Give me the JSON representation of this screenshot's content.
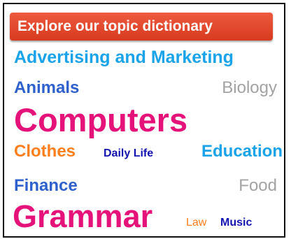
{
  "header": {
    "title": "Explore our topic dictionary"
  },
  "topics": [
    {
      "id": "advertising-and-marketing",
      "label": "Advertising and Marketing",
      "color": "#1aa3e8"
    },
    {
      "id": "animals",
      "label": "Animals",
      "color": "#2e61cc"
    },
    {
      "id": "biology",
      "label": "Biology",
      "color": "#a3a3a3"
    },
    {
      "id": "computers",
      "label": "Computers",
      "color": "#e5127a"
    },
    {
      "id": "clothes",
      "label": "Clothes",
      "color": "#ff7f1e"
    },
    {
      "id": "daily-life",
      "label": "Daily Life",
      "color": "#1414b0"
    },
    {
      "id": "education",
      "label": "Education",
      "color": "#1aa3e8"
    },
    {
      "id": "finance",
      "label": "Finance",
      "color": "#2e61cc"
    },
    {
      "id": "food",
      "label": "Food",
      "color": "#a3a3a3"
    },
    {
      "id": "grammar",
      "label": "Grammar",
      "color": "#e5127a"
    },
    {
      "id": "law",
      "label": "Law",
      "color": "#ff7f1e"
    },
    {
      "id": "music",
      "label": "Music",
      "color": "#1414b0"
    }
  ]
}
